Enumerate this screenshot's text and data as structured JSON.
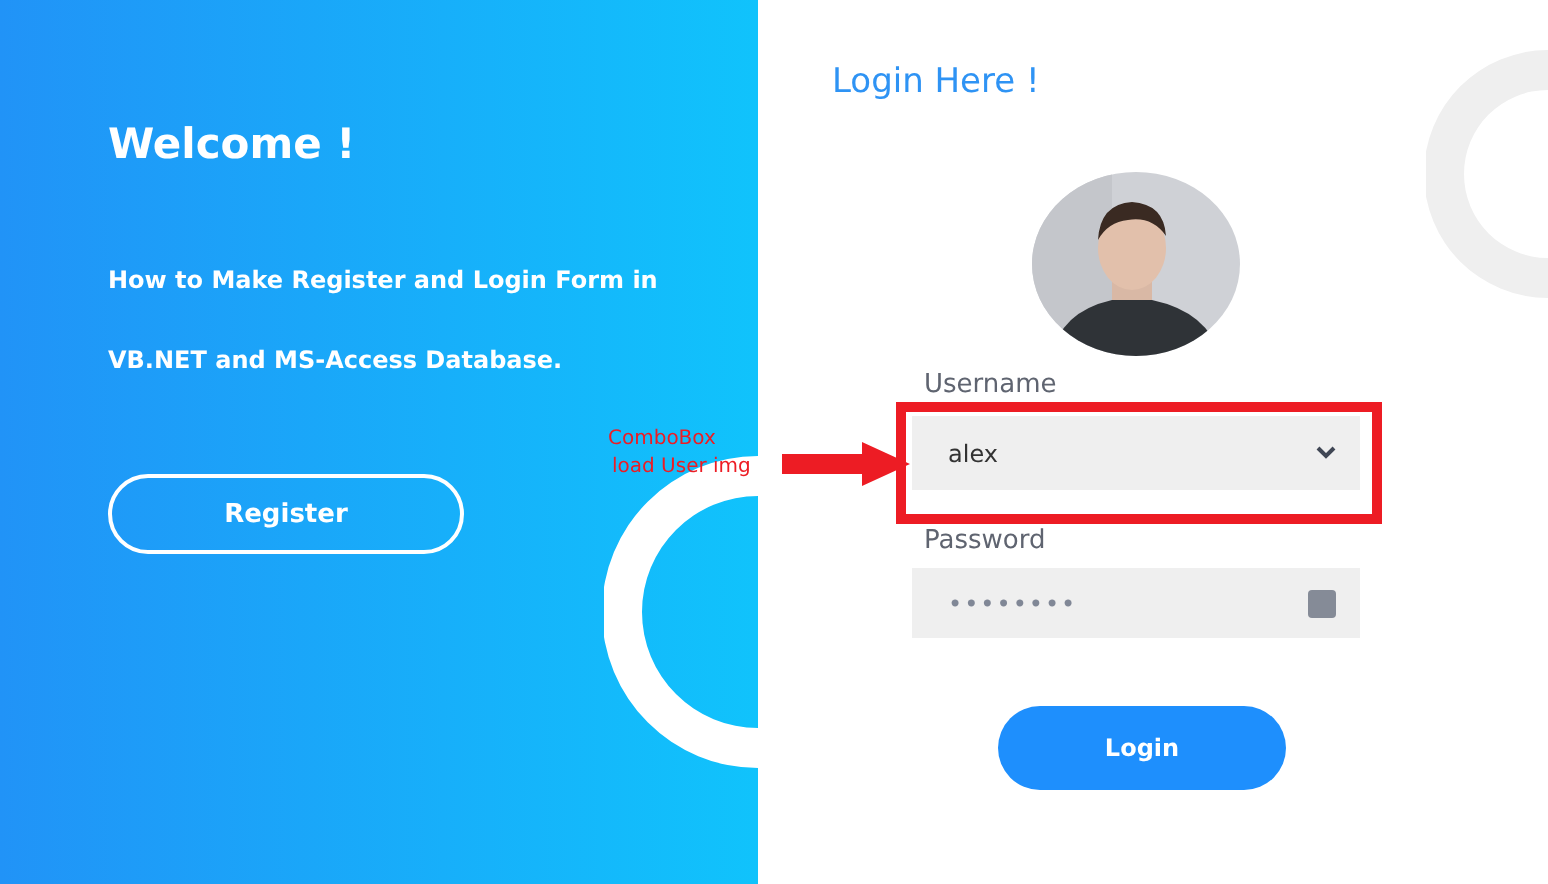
{
  "welcome": {
    "title": "Welcome !",
    "description": [
      "How to Make Register and Login Form in",
      "VB.NET and MS-Access Database."
    ],
    "register_button": "Register"
  },
  "login": {
    "title": "Login Here !",
    "username": {
      "label": "Username",
      "value": "alex"
    },
    "password": {
      "label": "Password",
      "value": "••••••••"
    },
    "login_button": "Login"
  },
  "annotation": {
    "lines": [
      "ComboBox",
      "load User img"
    ]
  }
}
